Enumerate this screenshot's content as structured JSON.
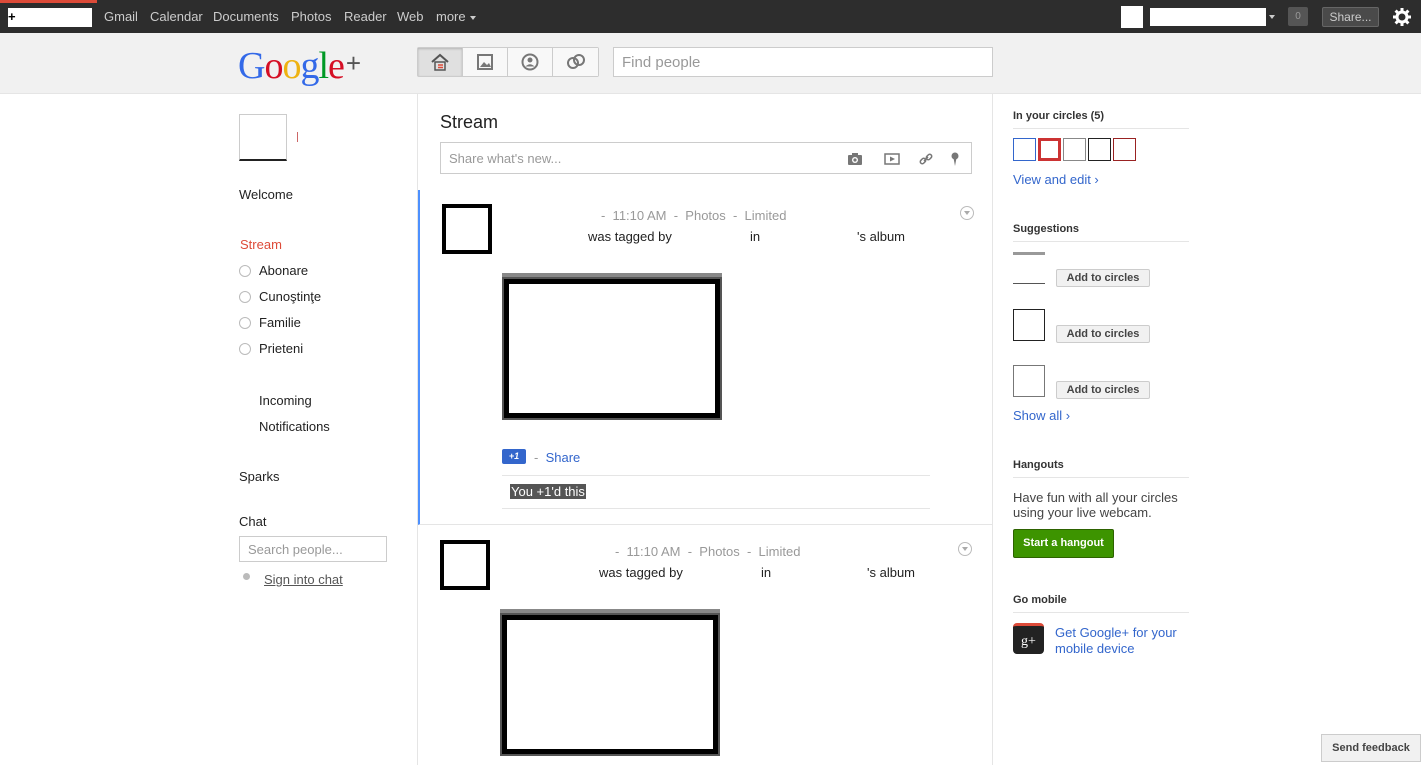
{
  "topbar": {
    "plus_label": "+",
    "links": [
      "Gmail",
      "Calendar",
      "Documents",
      "Photos",
      "Reader",
      "Web",
      "more"
    ],
    "notification_count": "0",
    "share_label": "Share..."
  },
  "header": {
    "logo_letters": [
      "G",
      "o",
      "o",
      "g",
      "l",
      "e"
    ],
    "logo_colors": [
      "#3369e8",
      "#d50f25",
      "#eeb211",
      "#3369e8",
      "#009925",
      "#d50f25"
    ],
    "logo_plus": "+",
    "nav_icons": [
      "home-icon",
      "photos-icon",
      "profile-icon",
      "circles-icon"
    ],
    "search_placeholder": "Find people"
  },
  "leftnav": {
    "welcome": "Welcome",
    "stream": "Stream",
    "circles": [
      "Abonare",
      "Cunoştinţe",
      "Familie",
      "Prieteni"
    ],
    "incoming": "Incoming",
    "notifications": "Notifications",
    "sparks": "Sparks",
    "chat": "Chat",
    "chat_search_placeholder": "Search people...",
    "sign_in_chat": "Sign into chat"
  },
  "stream": {
    "title": "Stream",
    "share_placeholder": "Share what's new...",
    "share_icons": [
      "camera-icon",
      "video-icon",
      "link-icon",
      "location-icon"
    ],
    "posts": [
      {
        "meta_time": "-  11:10 AM  -  Photos  -  Limited",
        "tagged_by": "was tagged by",
        "in": "in",
        "album": "'s album",
        "plus_one_badge": "+1",
        "share_sep": "-",
        "share_label": "Share",
        "you_plus_one": "You +1'd this"
      },
      {
        "meta_time": "-  11:10 AM  -  Photos  -  Limited",
        "tagged_by": "was tagged by",
        "in": "in",
        "album": "'s album"
      }
    ]
  },
  "right": {
    "in_circles": "In your circles (5)",
    "view_edit": "View and edit ›",
    "suggestions": "Suggestions",
    "add_to_circles": "Add to circles",
    "show_all": "Show all ›",
    "hangouts": "Hangouts",
    "hangouts_text": "Have fun with all your circles using your live webcam.",
    "start_hangout": "Start a hangout",
    "go_mobile": "Go mobile",
    "mobile_icon_text": "g+",
    "mobile_link": "Get Google+ for your mobile device"
  },
  "feedback": "Send feedback"
}
